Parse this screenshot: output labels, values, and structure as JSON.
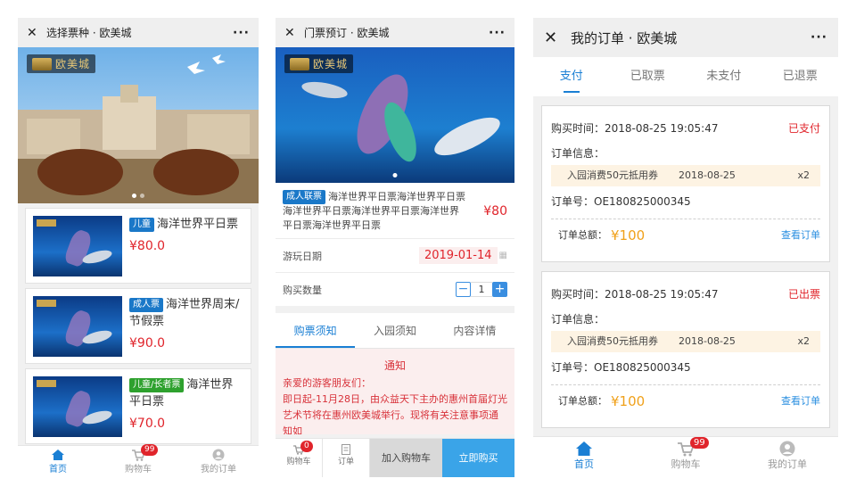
{
  "screen1": {
    "title": "选择票种 · 欧美城",
    "close_icon": "close-icon",
    "more_icon": "more-icon",
    "brand_text": "欧美城",
    "products": [
      {
        "tag": "儿童",
        "tag_color": "#1a78c8",
        "name": "海洋世界平日票",
        "price": "¥80.0"
      },
      {
        "tag": "成人票",
        "tag_color": "#1a78c8",
        "name": "海洋世界周末/节假票",
        "price": "¥90.0"
      },
      {
        "tag": "儿童/长者票",
        "tag_color": "#2ea12e",
        "name": "海洋世界平日票",
        "price": "¥70.0"
      }
    ],
    "tabbar": {
      "home": "首页",
      "cart": "购物车",
      "cart_badge": "99",
      "orders": "我的订单"
    }
  },
  "screen2": {
    "title": "门票预订 · 欧美城",
    "brand_text": "欧美城",
    "product_tag": "成人联票",
    "product_name": "海洋世界平日票海洋世界平日票海洋世界平日票海洋世界平日票海洋世界平日票海洋世界平日票",
    "product_price": "¥80",
    "visit_date_label": "游玩日期",
    "visit_date": "2019-01-14",
    "qty_label": "购买数量",
    "qty": "1",
    "tabs": [
      "购票须知",
      "入园须知",
      "内容详情"
    ],
    "notice_title": "通知",
    "notice_greeting": "亲爱的游客朋友们：",
    "notice_body": "即日起-11月28日，由众益天下主办的惠州首届灯光艺术节将在惠州欧美城举行。现将有关注意事项通知如",
    "bottom": {
      "cart_label": "购物车",
      "cart_badge": "0",
      "order_label": "订单",
      "add_cart": "加入购物车",
      "buy_now": "立即购买"
    }
  },
  "screen3": {
    "title": "我的订单 · 欧美城",
    "tabs": [
      "支付",
      "已取票",
      "未支付",
      "已退票"
    ],
    "orders": [
      {
        "time_label": "购买时间：",
        "time": "2018-08-25 19:05:47",
        "status": "已支付",
        "info_label": "订单信息：",
        "item_name": "入园消费50元抵用券",
        "item_date": "2018-08-25",
        "item_qty": "x2",
        "no_label": "订单号：",
        "no": "OE180825000345",
        "total_label": "订单总额：",
        "total": "¥100",
        "link": "查看订单"
      },
      {
        "time_label": "购买时间：",
        "time": "2018-08-25 19:05:47",
        "status": "已出票",
        "info_label": "订单信息：",
        "item_name": "入园消费50元抵用券",
        "item_date": "2018-08-25",
        "item_qty": "x2",
        "no_label": "订单号：",
        "no": "OE180825000345",
        "total_label": "订单总额：",
        "total": "¥100",
        "link": "查看订单"
      }
    ],
    "tabbar": {
      "home": "首页",
      "cart": "购物车",
      "cart_badge": "99",
      "orders": "我的订单"
    }
  },
  "colors": {
    "accent": "#1a7fd4",
    "price_red": "#e0242b",
    "amount_orange": "#f0a11b",
    "buy_button": "#3aa4e8"
  }
}
